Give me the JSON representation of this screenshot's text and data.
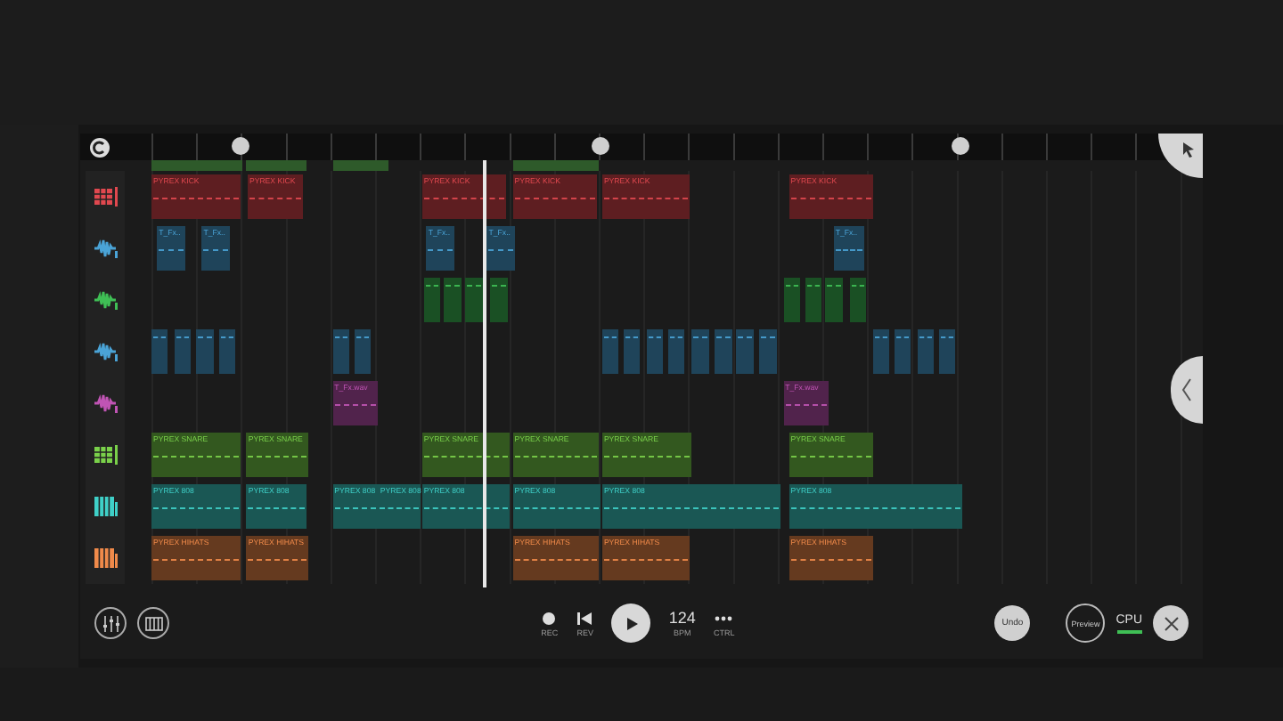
{
  "playhead": {
    "level": 0.316
  },
  "tracks": [
    {
      "kind": "drum",
      "color": "#e0484f",
      "clips": [
        {
          "label": "PYREX KICK"
        },
        {
          "label": "PYREX KICK"
        },
        {
          "label": "PYREX KICK"
        },
        {
          "label": "PYREX KICK"
        },
        {
          "label": "PYREX KICK"
        },
        {
          "label": "PYREX KICK"
        }
      ]
    },
    {
      "kind": "audio",
      "color": "#4aa3d6",
      "clips": [
        {
          "label": "T_Fx.."
        },
        {
          "label": "T_Fx.."
        },
        {
          "label": "T_Fx.."
        },
        {
          "label": "T_Fx.."
        },
        {
          "label": "T_Fx.."
        }
      ]
    },
    {
      "kind": "audio",
      "color": "#3fbf55"
    },
    {
      "kind": "audio",
      "color": "#4aa3d6"
    },
    {
      "kind": "audio",
      "color": "#c054b4",
      "clips": [
        {
          "label": "T_Fx.wav"
        },
        {
          "label": "T_Fx.wav"
        }
      ]
    },
    {
      "kind": "drum",
      "color": "#7ad14a",
      "clips": [
        {
          "label": "PYREX SNARE"
        },
        {
          "label": "PYREX SNARE"
        },
        {
          "label": "PYREX SNARE"
        },
        {
          "label": "PYREX SNARE"
        },
        {
          "label": "PYREX SNARE"
        },
        {
          "label": "PYREX SNARE"
        }
      ]
    },
    {
      "kind": "keys",
      "color": "#3fd0c8",
      "clips": [
        {
          "label": "PYREX 808"
        },
        {
          "label": "PYREX 808"
        },
        {
          "label": "PYREX 808"
        },
        {
          "label": "PYREX 808"
        },
        {
          "label": "PYREX 808"
        },
        {
          "label": "PYREX 808"
        },
        {
          "label": "PYREX 808"
        },
        {
          "label": "PYREX 808"
        }
      ]
    },
    {
      "kind": "keys",
      "color": "#f08a4a",
      "clips": [
        {
          "label": "PYREX HIHATS"
        },
        {
          "label": "PYREX HIHATS"
        },
        {
          "label": "PYREX HIHATS"
        },
        {
          "label": "PYREX HIHATS"
        },
        {
          "label": "PYREX HIHATS"
        }
      ]
    }
  ],
  "transport": [
    {
      "kind": "record",
      "caption": "REC"
    },
    {
      "kind": "rewind",
      "caption": "REV"
    },
    {
      "kind": "play"
    },
    {
      "kind": "tempo",
      "value": "124",
      "caption": "BPM"
    },
    {
      "kind": "more",
      "caption": "CTRL"
    }
  ],
  "undo_button": {
    "label": "Undo"
  },
  "preview_button": {
    "label": "Preview",
    "on": false
  },
  "cpu_meter": {
    "label": "CPU"
  }
}
